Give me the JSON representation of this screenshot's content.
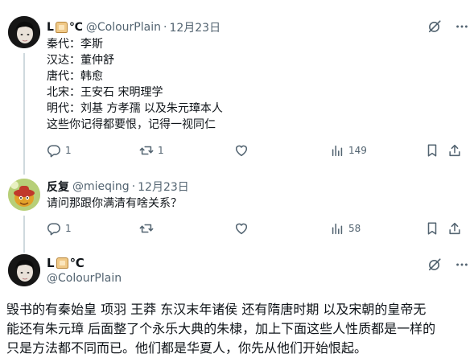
{
  "post1": {
    "name_prefix": "L",
    "name_suffix": "℃",
    "handle": "@ColourPlain",
    "separator": "·",
    "date": "12月23日",
    "lines": [
      "秦代：李斯",
      "汉达：董仲舒",
      "唐代：韩愈",
      "北宋：王安石 宋明理学",
      "明代：刘基  方孝孺  以及朱元璋本人",
      "这些你记得都要恨，记得一视同仁"
    ],
    "replies": "1",
    "reposts": "1",
    "likes": "",
    "views": "149"
  },
  "post2": {
    "name": "反复",
    "handle": "@mieqing",
    "separator": "·",
    "date": "12月23日",
    "text": "请问那跟你满清有啥关系？",
    "replies": "1",
    "reposts": "",
    "likes": "",
    "views": "58"
  },
  "main_post": {
    "name_prefix": "L",
    "name_suffix": "℃",
    "handle": "@ColourPlain",
    "lines": [
      "毁书的有秦始皇  项羽  王莽  东汉末年诸侯 还有隋唐时期 以及宋朝的皇帝无",
      "能还有朱元璋 后面整了个永乐大典的朱棣，加上下面这些人性质都是一样的",
      "只是方法都不同而已。他们都是华夏人，你先从他们开始恨起。"
    ]
  },
  "icons": {
    "grok": "grok-icon",
    "more": "more-dots-icon",
    "reply": "reply-icon",
    "repost": "repost-icon",
    "like": "heart-icon",
    "views": "views-icon",
    "bookmark": "bookmark-icon",
    "share": "share-icon"
  },
  "colors": {
    "text": "#0f1419",
    "secondary": "#536471",
    "divider": "#eff3f4",
    "thread_line": "#cfd9de"
  }
}
